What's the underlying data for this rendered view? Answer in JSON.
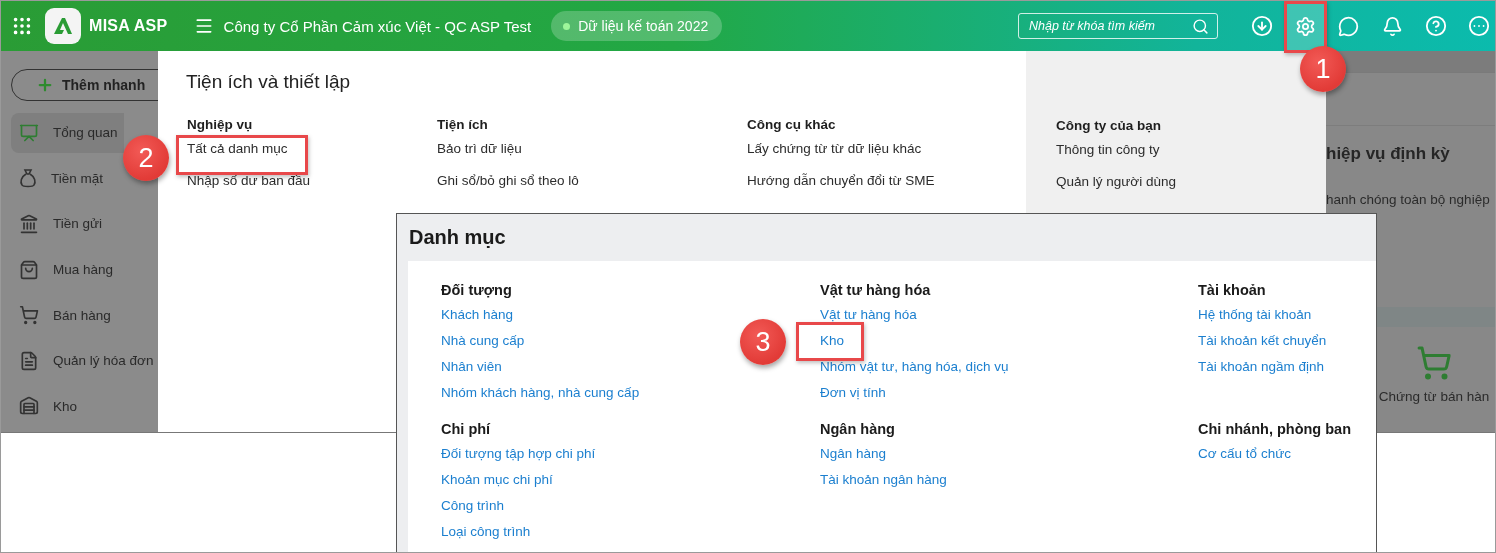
{
  "header": {
    "app_name": "MISA ASP",
    "company": "Công ty Cổ Phần Cảm xúc Việt - QC ASP Test",
    "data_badge": "Dữ liệu kế toán 2022",
    "search": {
      "placeholder": "Nhập từ khóa tìm kiếm"
    }
  },
  "sidebar": {
    "quick_add": "Thêm nhanh",
    "items": [
      {
        "label": "Tổng quan",
        "selected": true
      },
      {
        "label": "Tiền mặt",
        "selected": false
      },
      {
        "label": "Tiền gửi",
        "selected": false
      },
      {
        "label": "Mua hàng",
        "selected": false
      },
      {
        "label": "Bán hàng",
        "selected": false
      },
      {
        "label": "Quản lý hóa đơn",
        "selected": false
      },
      {
        "label": "Kho",
        "selected": false
      }
    ]
  },
  "settings_panel": {
    "title": "Tiện ích và thiết lập",
    "columns": [
      {
        "heading": "Nghiệp vụ",
        "items": [
          "Tất cả danh mục",
          "Nhập số dư ban đầu"
        ]
      },
      {
        "heading": "Tiện ích",
        "items": [
          "Bảo trì dữ liệu",
          "Ghi sổ/bỏ ghi sổ theo lô"
        ]
      },
      {
        "heading": "Công cụ khác",
        "items": [
          "Lấy chứng từ từ dữ liệu khác",
          "Hướng dẫn chuyển đổi từ SME"
        ]
      },
      {
        "heading": "Công ty của bạn",
        "items": [
          "Thông tin công ty",
          "Quản lý người dùng"
        ]
      }
    ]
  },
  "background_panel": {
    "heading": "hiệp vụ định kỳ",
    "text": "hanh chóng toàn bộ nghiệp",
    "shortcut": "Chứng từ bán hàn"
  },
  "catalog_panel": {
    "title": "Danh mục",
    "columns": [
      {
        "groups": [
          {
            "heading": "Đối tượng",
            "items": [
              "Khách hàng",
              "Nhà cung cấp",
              "Nhân viên",
              "Nhóm khách hàng, nhà cung cấp"
            ]
          },
          {
            "heading": "Chi phí",
            "items": [
              "Đối tượng tập hợp chi phí",
              "Khoản mục chi phí",
              "Công trình",
              "Loại công trình"
            ]
          }
        ]
      },
      {
        "groups": [
          {
            "heading": "Vật tư hàng hóa",
            "items": [
              "Vật tư hàng hóa",
              "Kho",
              "Nhóm vật tư, hàng hóa, dịch vụ",
              "Đơn vị tính"
            ]
          },
          {
            "heading": "Ngân hàng",
            "items": [
              "Ngân hàng",
              "Tài khoản ngân hàng"
            ]
          }
        ]
      },
      {
        "groups": [
          {
            "heading": "Tài khoản",
            "items": [
              "Hệ thống tài khoản",
              "Tài khoản kết chuyển",
              "Tài khoản ngầm định"
            ]
          },
          {
            "heading": "Chi nhánh, phòng ban",
            "items": [
              "Cơ cấu tổ chức"
            ]
          }
        ]
      }
    ]
  },
  "callouts": [
    {
      "number": "1"
    },
    {
      "number": "2"
    },
    {
      "number": "3"
    }
  ]
}
